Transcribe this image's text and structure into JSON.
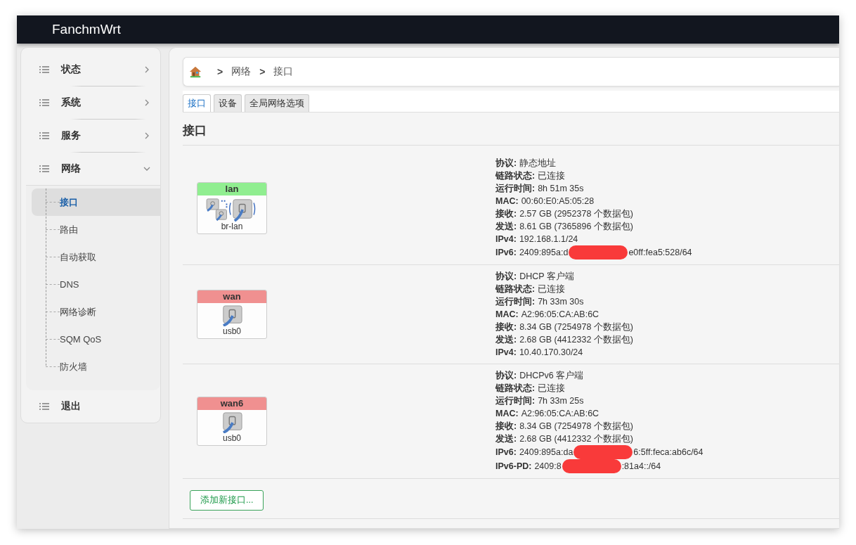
{
  "brand": "FanchmWrt",
  "sidebar": {
    "items": [
      {
        "label": "状态",
        "expanded": false
      },
      {
        "label": "系统",
        "expanded": false
      },
      {
        "label": "服务",
        "expanded": false
      },
      {
        "label": "网络",
        "expanded": true,
        "children": [
          {
            "label": "接口",
            "selected": true
          },
          {
            "label": "路由",
            "selected": false
          },
          {
            "label": "自动获取",
            "selected": false
          },
          {
            "label": "DNS",
            "selected": false
          },
          {
            "label": "网络诊断",
            "selected": false
          },
          {
            "label": "SQM QoS",
            "selected": false
          },
          {
            "label": "防火墙",
            "selected": false
          }
        ]
      },
      {
        "label": "退出",
        "expanded": false
      }
    ]
  },
  "breadcrumb": [
    {
      "label": ">"
    },
    {
      "label": "网络"
    },
    {
      "label": ">"
    },
    {
      "label": "接口"
    }
  ],
  "tabs": [
    {
      "label": "接口",
      "selected": true
    },
    {
      "label": "设备",
      "selected": false
    },
    {
      "label": "全局网络选项",
      "selected": false
    }
  ],
  "heading": "接口",
  "interfaces": [
    {
      "name": "lan",
      "color": "#90ee90",
      "kind": "bridge",
      "device": "br-lan",
      "info": [
        {
          "label": "协议:",
          "value": "静态地址"
        },
        {
          "label": "链路状态:",
          "value": "已连接"
        },
        {
          "label": "运行时间:",
          "value": "8h 51m 35s"
        },
        {
          "label": "MAC:",
          "value": "00:60:E0:A5:05:28"
        },
        {
          "label": "接收:",
          "value": "2.57 GB (2952378 个数据包)"
        },
        {
          "label": "发送:",
          "value": "8.61 GB (7365896 个数据包)"
        },
        {
          "label": "IPv4:",
          "value": "192.168.1.1/24"
        },
        {
          "label": "IPv6:",
          "value": "2409:895a:d",
          "value_after": "e0ff:fea5:528/64"
        }
      ]
    },
    {
      "name": "wan",
      "color": "#f09090",
      "kind": "ethernet",
      "device": "usb0",
      "info": [
        {
          "label": "协议:",
          "value": "DHCP 客户端"
        },
        {
          "label": "链路状态:",
          "value": "已连接"
        },
        {
          "label": "运行时间:",
          "value": "7h 33m 30s"
        },
        {
          "label": "MAC:",
          "value": "A2:96:05:CA:AB:6C"
        },
        {
          "label": "接收:",
          "value": "8.34 GB (7254978 个数据包)"
        },
        {
          "label": "发送:",
          "value": "2.68 GB (4412332 个数据包)"
        },
        {
          "label": "IPv4:",
          "value": "10.40.170.30/24"
        }
      ]
    },
    {
      "name": "wan6",
      "color": "#f09090",
      "kind": "ethernet",
      "device": "usb0",
      "info": [
        {
          "label": "协议:",
          "value": "DHCPv6 客户端"
        },
        {
          "label": "链路状态:",
          "value": "已连接"
        },
        {
          "label": "运行时间:",
          "value": "7h 33m 25s"
        },
        {
          "label": "MAC:",
          "value": "A2:96:05:CA:AB:6C"
        },
        {
          "label": "接收:",
          "value": "8.34 GB (7254978 个数据包)"
        },
        {
          "label": "发送:",
          "value": "2.68 GB (4412332 个数据包)"
        },
        {
          "label": "IPv6:",
          "value": "2409:895a:da",
          "value_after": "6:5ff:feca:ab6c/64"
        },
        {
          "label": "IPv6-PD:",
          "value": "2409:8",
          "value_after": ":81a4::/64"
        }
      ]
    }
  ],
  "add_button": "添加新接口..."
}
